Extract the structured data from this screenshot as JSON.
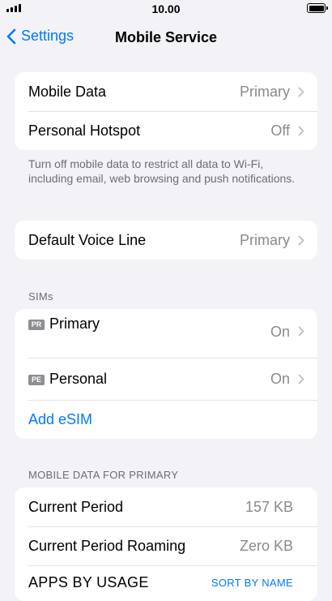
{
  "status": {
    "time": "10.00"
  },
  "nav": {
    "back_label": "Settings",
    "title": "Mobile Service"
  },
  "data_card": {
    "rows": [
      {
        "label": "Mobile Data",
        "value": "Primary"
      },
      {
        "label": "Personal Hotspot",
        "value": "Off"
      }
    ]
  },
  "data_note": "Turn off mobile data to restrict all data to Wi-Fi, including email, web browsing and push notifications.",
  "voice_card": {
    "label": "Default Voice Line",
    "value": "Primary"
  },
  "sims": {
    "header": "SIMs",
    "items": [
      {
        "badge": "PR",
        "label": "Primary",
        "value": "On"
      },
      {
        "badge": "PE",
        "label": "Personal",
        "value": "On"
      }
    ],
    "add_label": "Add eSIM"
  },
  "usage": {
    "header": "MOBILE DATA FOR PRIMARY",
    "rows": [
      {
        "label": "Current Period",
        "value": "157 KB"
      },
      {
        "label": "Current Period Roaming",
        "value": "Zero KB"
      }
    ],
    "apps_label": "APPS BY USAGE",
    "sort_label": "SORT BY NAME"
  }
}
